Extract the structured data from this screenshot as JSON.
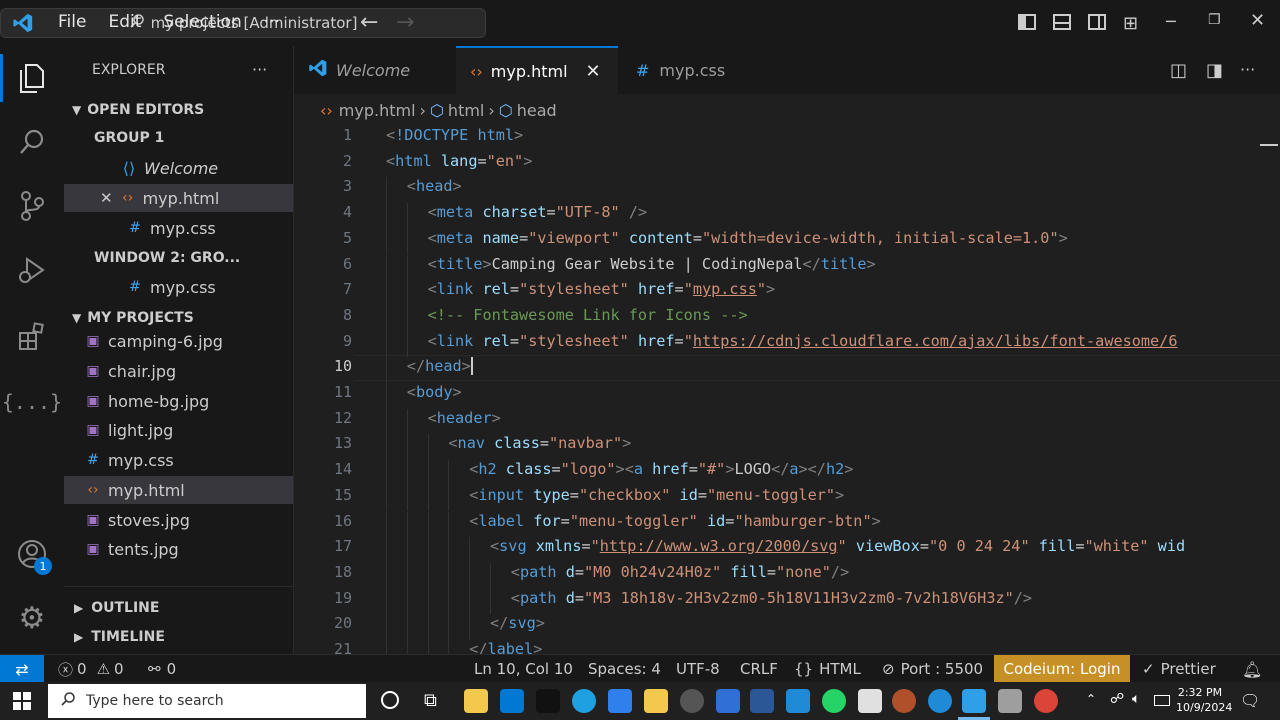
{
  "titlebar": {
    "menu": [
      "File",
      "Edit",
      "Selection",
      "···"
    ],
    "search": "my projects [Administrator]"
  },
  "activity": {
    "badge": "1"
  },
  "sidebar": {
    "title": "EXPLORER",
    "more": "···",
    "open_editors": "OPEN EDITORS",
    "group1": "GROUP 1",
    "open_items": [
      {
        "icon": "vscode-icon",
        "label": "Welcome"
      },
      {
        "icon": "html-icon",
        "label": "myp.html"
      },
      {
        "icon": "css-icon",
        "label": "myp.css"
      }
    ],
    "window2": "WINDOW 2: GRO...",
    "window2_items": [
      {
        "icon": "css-icon",
        "label": "myp.css"
      }
    ],
    "project": "MY PROJECTS",
    "files": [
      {
        "icon": "image-icon",
        "label": "camping-6.jpg"
      },
      {
        "icon": "image-icon",
        "label": "chair.jpg"
      },
      {
        "icon": "image-icon",
        "label": "home-bg.jpg"
      },
      {
        "icon": "image-icon",
        "label": "light.jpg"
      },
      {
        "icon": "css-icon",
        "label": "myp.css"
      },
      {
        "icon": "html-icon",
        "label": "myp.html"
      },
      {
        "icon": "image-icon",
        "label": "stoves.jpg"
      },
      {
        "icon": "image-icon",
        "label": "tents.jpg"
      }
    ],
    "outline": "OUTLINE",
    "timeline": "TIMELINE"
  },
  "tabs": [
    {
      "label": "Welcome",
      "icon": "vscode-icon",
      "active": false
    },
    {
      "label": "myp.html",
      "icon": "html-icon",
      "active": true
    },
    {
      "label": "myp.css",
      "icon": "css-icon",
      "active": false
    }
  ],
  "breadcrumb": [
    "myp.html",
    "html",
    "head"
  ],
  "editor": {
    "line_numbers": [
      "1",
      "2",
      "3",
      "4",
      "5",
      "6",
      "7",
      "8",
      "9",
      "10",
      "11",
      "12",
      "13",
      "14",
      "15",
      "16",
      "17",
      "18",
      "19",
      "20",
      "21"
    ],
    "current_line": "10"
  },
  "status": {
    "errors": "0",
    "warnings": "0",
    "ports": "0",
    "position": "Ln 10, Col 10",
    "spaces": "Spaces: 4",
    "encoding": "UTF-8",
    "eol": "CRLF",
    "language": "HTML",
    "port": "Port : 5500",
    "codeium": "Codeium: Login",
    "prettier": "Prettier"
  },
  "taskbar": {
    "search_placeholder": "Type here to search",
    "time": "2:32 PM",
    "date": "10/9/2024"
  },
  "colors": {
    "accent": "#0078d4",
    "codeium": "#c69026",
    "remote": "#0078d4"
  }
}
